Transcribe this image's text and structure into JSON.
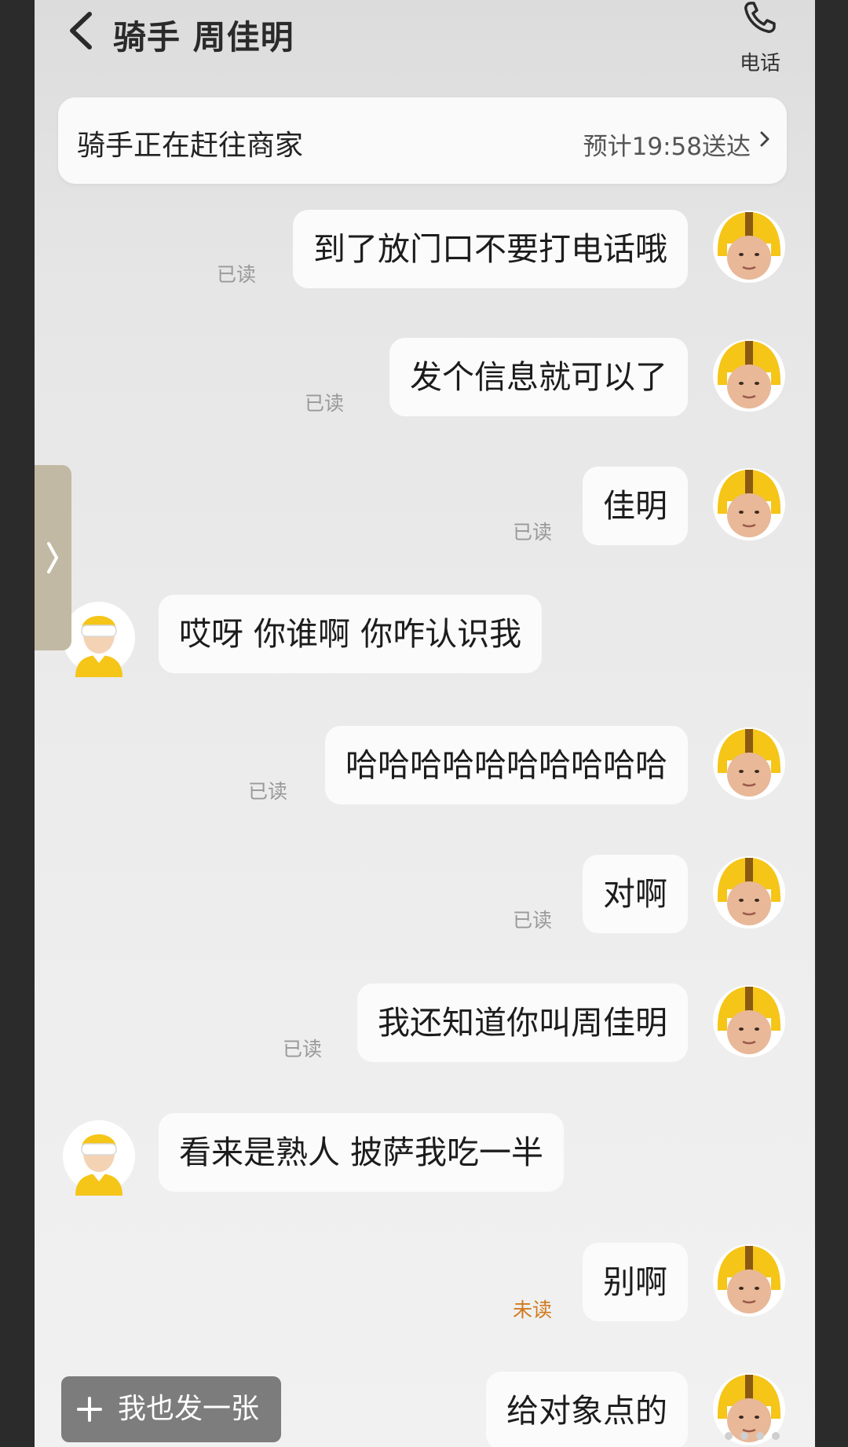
{
  "header": {
    "title": "骑手 周佳明",
    "call_label": "电话"
  },
  "status": {
    "text": "骑手正在赶往商家",
    "eta": "预计19:58送达"
  },
  "messages": [
    {
      "from": "me",
      "text": "到了放门口不要打电话哦",
      "status": "已读"
    },
    {
      "from": "me",
      "text": "发个信息就可以了",
      "status": "已读"
    },
    {
      "from": "me",
      "text": "佳明",
      "status": "已读"
    },
    {
      "from": "rider",
      "text": "哎呀 你谁啊 你咋认识我"
    },
    {
      "from": "me",
      "text": "哈哈哈哈哈哈哈哈哈哈",
      "status": "已读"
    },
    {
      "from": "me",
      "text": "对啊",
      "status": "已读"
    },
    {
      "from": "me",
      "text": "我还知道你叫周佳明",
      "status": "已读"
    },
    {
      "from": "rider",
      "text": "看来是熟人 披萨我吃一半"
    },
    {
      "from": "me",
      "text": "别啊",
      "status": "未读"
    },
    {
      "from": "me",
      "text": "给对象点的"
    }
  ],
  "bottom": {
    "post_label": "我也发一张"
  },
  "colors": {
    "helmet_yellow": "#f5c518",
    "helmet_stripe": "#8a5a12",
    "unread": "#d07a1e",
    "read": "#999999"
  },
  "icons": {
    "back": "chevron-left-icon",
    "call": "phone-icon",
    "status": "chevron-right-icon",
    "side": "chevron-right-icon",
    "post": "plus-icon"
  }
}
